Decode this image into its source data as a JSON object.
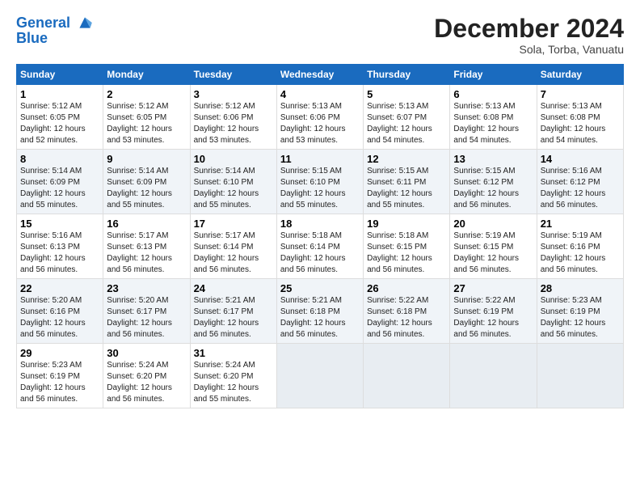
{
  "logo": {
    "line1": "General",
    "line2": "Blue"
  },
  "title": "December 2024",
  "subtitle": "Sola, Torba, Vanuatu",
  "days_of_week": [
    "Sunday",
    "Monday",
    "Tuesday",
    "Wednesday",
    "Thursday",
    "Friday",
    "Saturday"
  ],
  "weeks": [
    [
      {
        "day": 1,
        "sunrise": "5:12 AM",
        "sunset": "6:05 PM",
        "daylight": "12 hours and 52 minutes."
      },
      {
        "day": 2,
        "sunrise": "5:12 AM",
        "sunset": "6:05 PM",
        "daylight": "12 hours and 53 minutes."
      },
      {
        "day": 3,
        "sunrise": "5:12 AM",
        "sunset": "6:06 PM",
        "daylight": "12 hours and 53 minutes."
      },
      {
        "day": 4,
        "sunrise": "5:13 AM",
        "sunset": "6:06 PM",
        "daylight": "12 hours and 53 minutes."
      },
      {
        "day": 5,
        "sunrise": "5:13 AM",
        "sunset": "6:07 PM",
        "daylight": "12 hours and 54 minutes."
      },
      {
        "day": 6,
        "sunrise": "5:13 AM",
        "sunset": "6:08 PM",
        "daylight": "12 hours and 54 minutes."
      },
      {
        "day": 7,
        "sunrise": "5:13 AM",
        "sunset": "6:08 PM",
        "daylight": "12 hours and 54 minutes."
      }
    ],
    [
      {
        "day": 8,
        "sunrise": "5:14 AM",
        "sunset": "6:09 PM",
        "daylight": "12 hours and 55 minutes."
      },
      {
        "day": 9,
        "sunrise": "5:14 AM",
        "sunset": "6:09 PM",
        "daylight": "12 hours and 55 minutes."
      },
      {
        "day": 10,
        "sunrise": "5:14 AM",
        "sunset": "6:10 PM",
        "daylight": "12 hours and 55 minutes."
      },
      {
        "day": 11,
        "sunrise": "5:15 AM",
        "sunset": "6:10 PM",
        "daylight": "12 hours and 55 minutes."
      },
      {
        "day": 12,
        "sunrise": "5:15 AM",
        "sunset": "6:11 PM",
        "daylight": "12 hours and 55 minutes."
      },
      {
        "day": 13,
        "sunrise": "5:15 AM",
        "sunset": "6:12 PM",
        "daylight": "12 hours and 56 minutes."
      },
      {
        "day": 14,
        "sunrise": "5:16 AM",
        "sunset": "6:12 PM",
        "daylight": "12 hours and 56 minutes."
      }
    ],
    [
      {
        "day": 15,
        "sunrise": "5:16 AM",
        "sunset": "6:13 PM",
        "daylight": "12 hours and 56 minutes."
      },
      {
        "day": 16,
        "sunrise": "5:17 AM",
        "sunset": "6:13 PM",
        "daylight": "12 hours and 56 minutes."
      },
      {
        "day": 17,
        "sunrise": "5:17 AM",
        "sunset": "6:14 PM",
        "daylight": "12 hours and 56 minutes."
      },
      {
        "day": 18,
        "sunrise": "5:18 AM",
        "sunset": "6:14 PM",
        "daylight": "12 hours and 56 minutes."
      },
      {
        "day": 19,
        "sunrise": "5:18 AM",
        "sunset": "6:15 PM",
        "daylight": "12 hours and 56 minutes."
      },
      {
        "day": 20,
        "sunrise": "5:19 AM",
        "sunset": "6:15 PM",
        "daylight": "12 hours and 56 minutes."
      },
      {
        "day": 21,
        "sunrise": "5:19 AM",
        "sunset": "6:16 PM",
        "daylight": "12 hours and 56 minutes."
      }
    ],
    [
      {
        "day": 22,
        "sunrise": "5:20 AM",
        "sunset": "6:16 PM",
        "daylight": "12 hours and 56 minutes."
      },
      {
        "day": 23,
        "sunrise": "5:20 AM",
        "sunset": "6:17 PM",
        "daylight": "12 hours and 56 minutes."
      },
      {
        "day": 24,
        "sunrise": "5:21 AM",
        "sunset": "6:17 PM",
        "daylight": "12 hours and 56 minutes."
      },
      {
        "day": 25,
        "sunrise": "5:21 AM",
        "sunset": "6:18 PM",
        "daylight": "12 hours and 56 minutes."
      },
      {
        "day": 26,
        "sunrise": "5:22 AM",
        "sunset": "6:18 PM",
        "daylight": "12 hours and 56 minutes."
      },
      {
        "day": 27,
        "sunrise": "5:22 AM",
        "sunset": "6:19 PM",
        "daylight": "12 hours and 56 minutes."
      },
      {
        "day": 28,
        "sunrise": "5:23 AM",
        "sunset": "6:19 PM",
        "daylight": "12 hours and 56 minutes."
      }
    ],
    [
      {
        "day": 29,
        "sunrise": "5:23 AM",
        "sunset": "6:19 PM",
        "daylight": "12 hours and 56 minutes."
      },
      {
        "day": 30,
        "sunrise": "5:24 AM",
        "sunset": "6:20 PM",
        "daylight": "12 hours and 56 minutes."
      },
      {
        "day": 31,
        "sunrise": "5:24 AM",
        "sunset": "6:20 PM",
        "daylight": "12 hours and 55 minutes."
      },
      null,
      null,
      null,
      null
    ]
  ]
}
